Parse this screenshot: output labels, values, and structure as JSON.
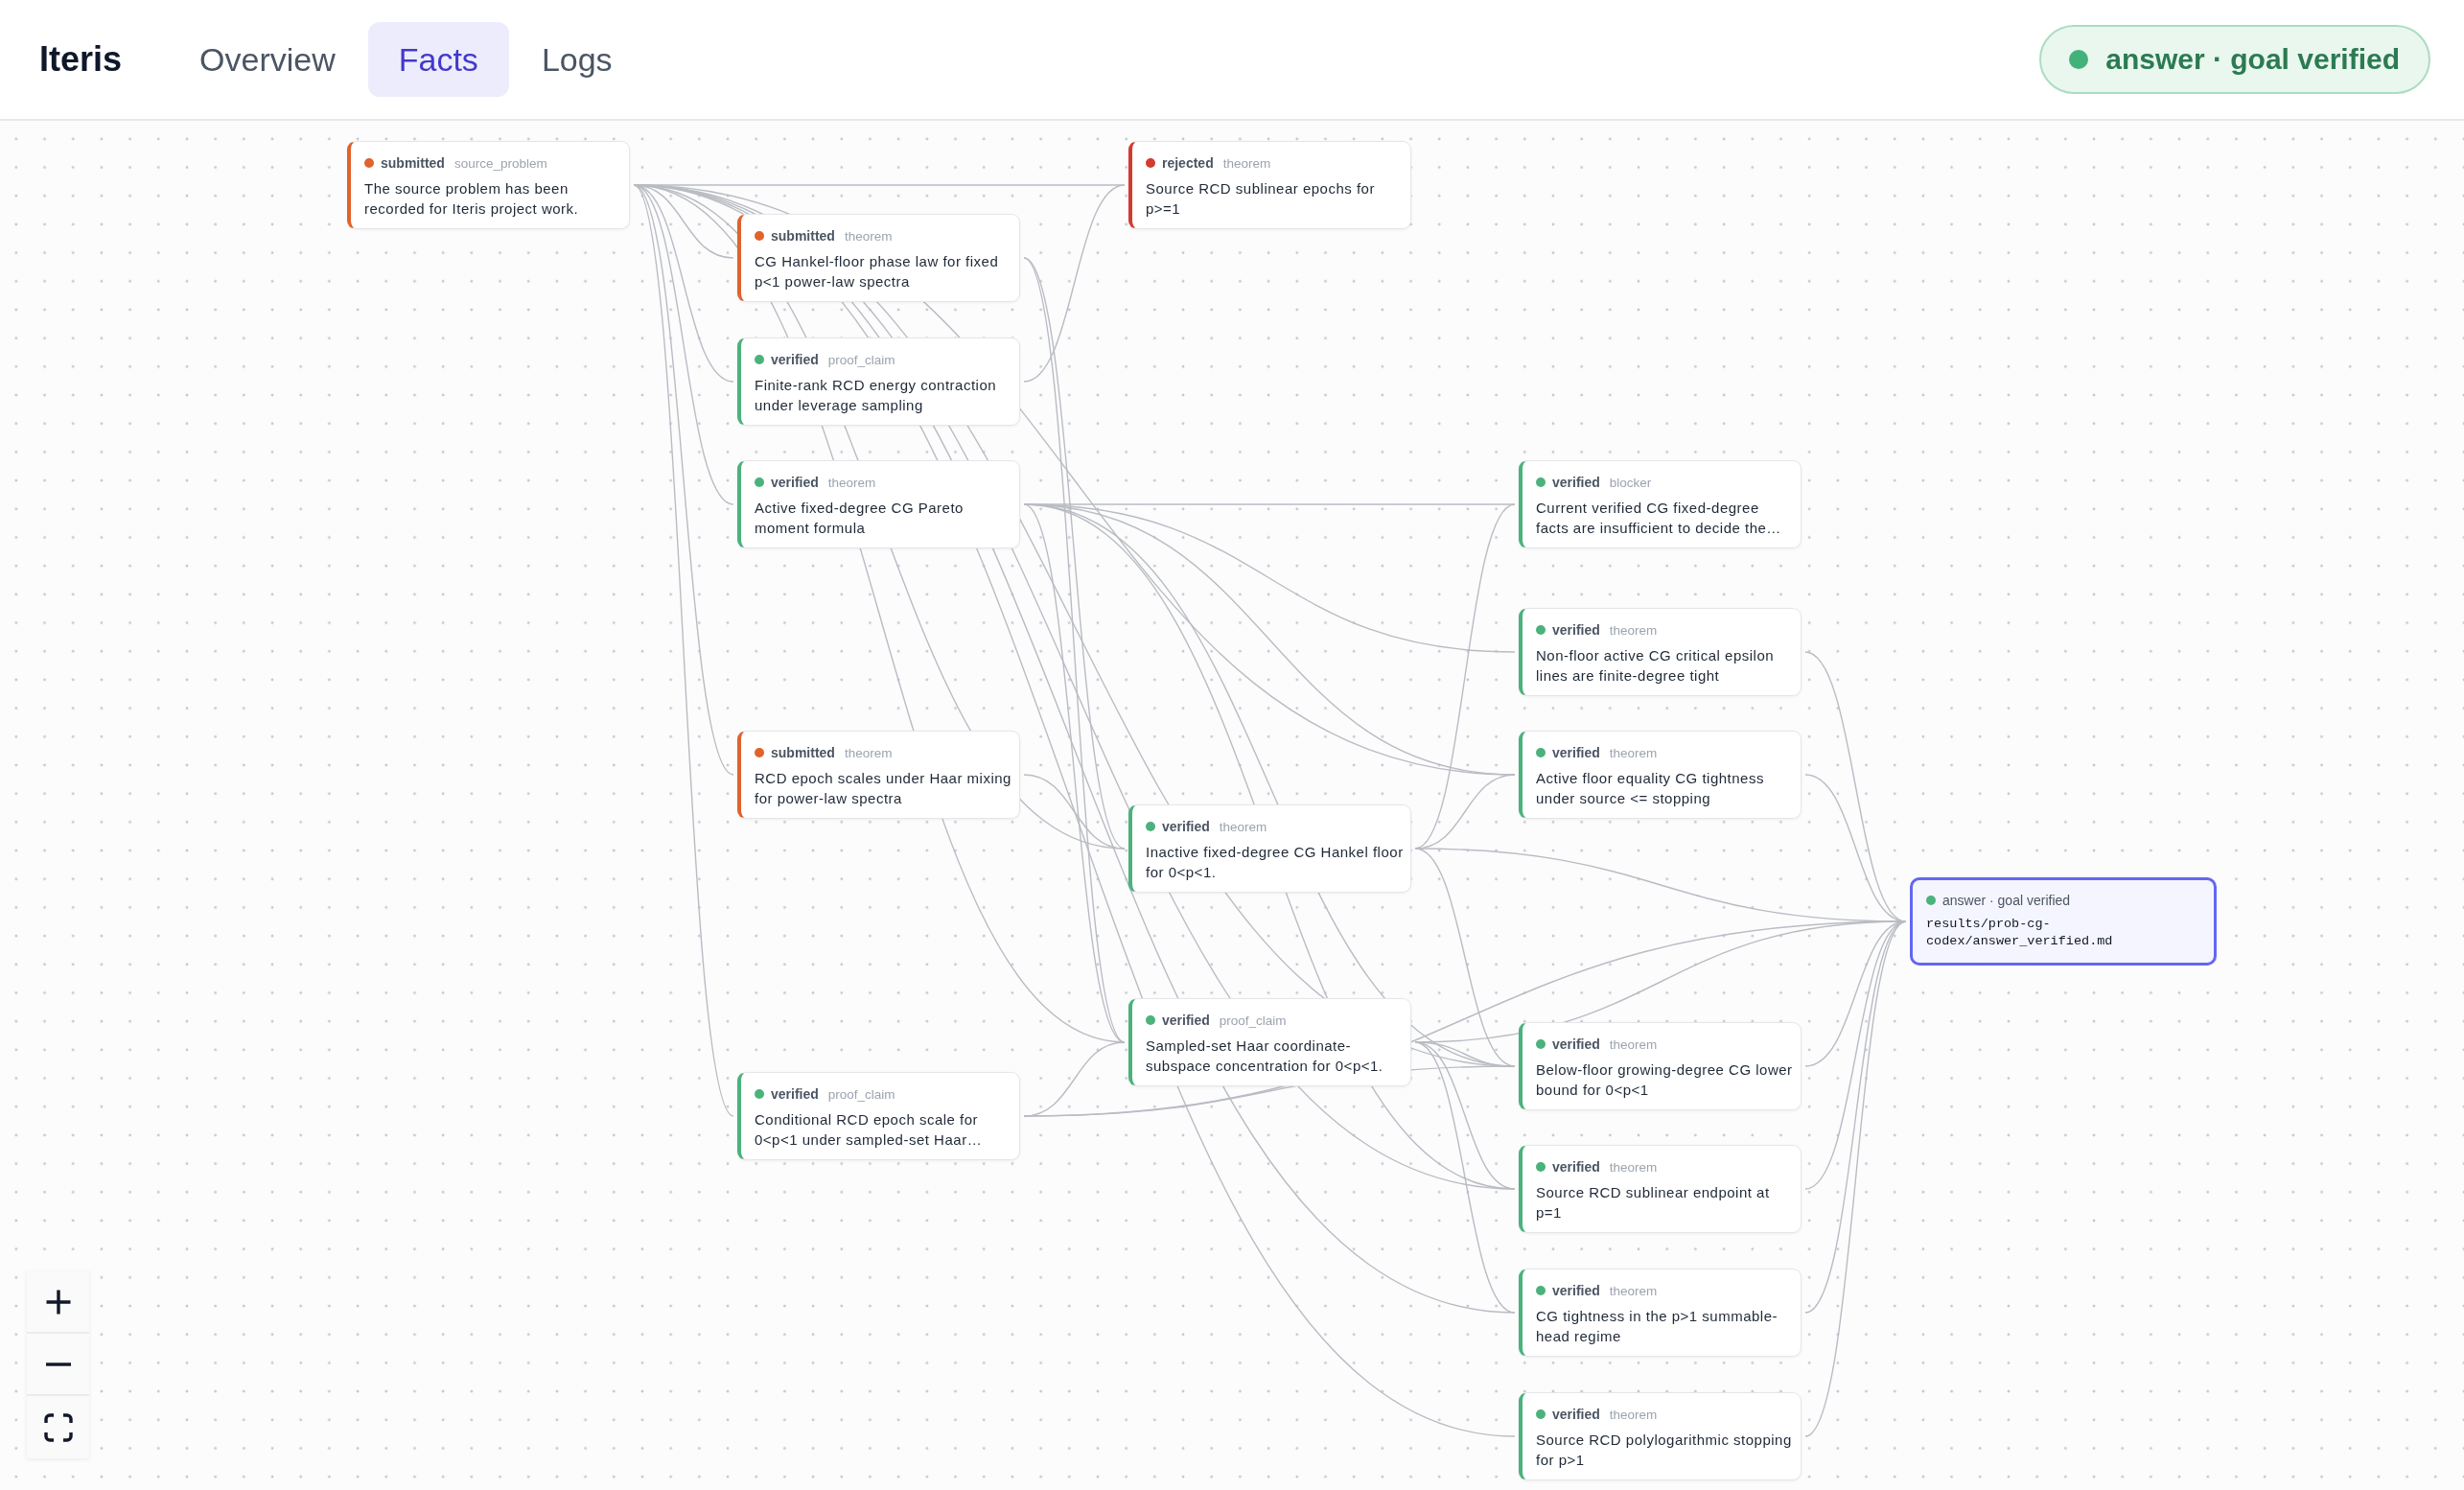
{
  "app_title": "Iteris",
  "tabs": [
    {
      "label": "Overview",
      "selected": false
    },
    {
      "label": "Facts",
      "selected": true
    },
    {
      "label": "Logs",
      "selected": false
    }
  ],
  "status_badge": {
    "label": "answer · goal verified"
  },
  "graph": {
    "nodes": [
      {
        "kind": "fact",
        "status": "submitted",
        "type": "source_problem",
        "text": "The source problem has been recorded for Iteris project work.",
        "color": "#e0632b"
      },
      {
        "kind": "fact",
        "status": "rejected",
        "type": "theorem",
        "text": "Source RCD sublinear epochs for p>=1",
        "color": "#d33b30"
      },
      {
        "kind": "fact",
        "status": "submitted",
        "type": "theorem",
        "text": "CG Hankel-floor phase law for fixed p<1 power-law spectra",
        "color": "#e0632b"
      },
      {
        "kind": "fact",
        "status": "verified",
        "type": "proof_claim",
        "text": "Finite-rank RCD energy contraction under leverage sampling",
        "color": "#4bb27c"
      },
      {
        "kind": "fact",
        "status": "verified",
        "type": "theorem",
        "text": "Active fixed-degree CG Pareto moment formula",
        "color": "#4bb27c"
      },
      {
        "kind": "fact",
        "status": "verified",
        "type": "blocker",
        "text": "Current verified CG fixed-degree facts are insufficient to decide the…",
        "color": "#4bb27c"
      },
      {
        "kind": "fact",
        "status": "verified",
        "type": "theorem",
        "text": "Non-floor active CG critical epsilon lines are finite-degree tight",
        "color": "#4bb27c"
      },
      {
        "kind": "fact",
        "status": "submitted",
        "type": "theorem",
        "text": "RCD epoch scales under Haar mixing for power-law spectra",
        "color": "#e0632b"
      },
      {
        "kind": "fact",
        "status": "verified",
        "type": "theorem",
        "text": "Active floor equality CG tightness under source <= stopping",
        "color": "#4bb27c"
      },
      {
        "kind": "fact",
        "status": "verified",
        "type": "theorem",
        "text": "Inactive fixed-degree CG Hankel floor for 0<p<1.",
        "color": "#4bb27c"
      },
      {
        "kind": "answer",
        "label": "answer · goal verified",
        "path": "results/prob-cg-codex/answer_verified.md",
        "color": "#4bb27c"
      },
      {
        "kind": "fact",
        "status": "verified",
        "type": "proof_claim",
        "text": "Sampled-set Haar coordinate-subspace concentration for 0<p<1.",
        "color": "#4bb27c"
      },
      {
        "kind": "fact",
        "status": "verified",
        "type": "theorem",
        "text": "Below-floor growing-degree CG lower bound for 0<p<1",
        "color": "#4bb27c"
      },
      {
        "kind": "fact",
        "status": "verified",
        "type": "proof_claim",
        "text": "Conditional RCD epoch scale for 0<p<1 under sampled-set Haar…",
        "color": "#4bb27c"
      },
      {
        "kind": "fact",
        "status": "verified",
        "type": "theorem",
        "text": "Source RCD sublinear endpoint at p=1",
        "color": "#4bb27c"
      },
      {
        "kind": "fact",
        "status": "verified",
        "type": "theorem",
        "text": "CG tightness in the p>1 summable-head regime",
        "color": "#4bb27c"
      },
      {
        "kind": "fact",
        "status": "verified",
        "type": "theorem",
        "text": "Source RCD polylogarithmic stopping for p>1",
        "color": "#4bb27c"
      }
    ]
  }
}
